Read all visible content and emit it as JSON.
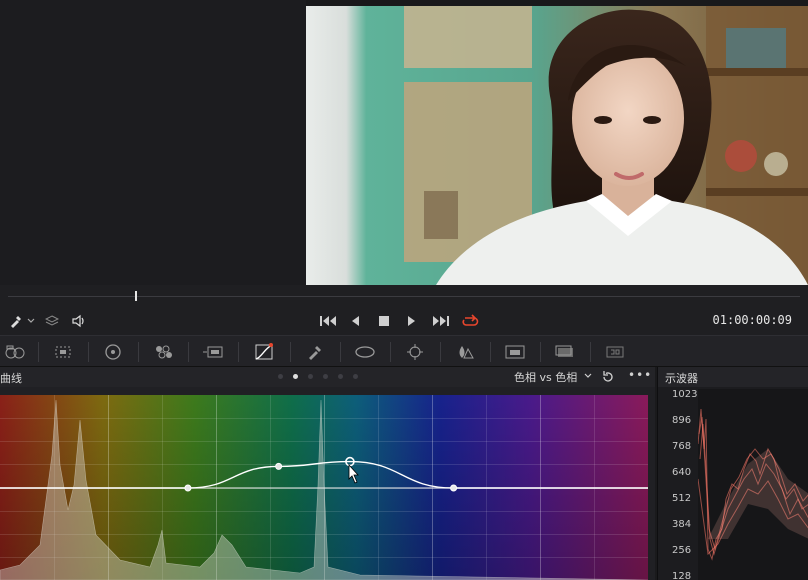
{
  "transport": {
    "timecode": "01:00:00:09",
    "playhead_fraction": 0.16,
    "loop_color": "#e8462d"
  },
  "curves": {
    "title": "曲线",
    "mode_label": "色相 vs 色相",
    "page_count": 6,
    "active_page": 1,
    "more_label": "•••",
    "control_points": [
      {
        "hue": 0.29,
        "offset": 0.0
      },
      {
        "hue": 0.43,
        "offset": 0.18
      },
      {
        "hue": 0.54,
        "offset": 0.22
      },
      {
        "hue": 0.7,
        "offset": 0.0
      }
    ],
    "active_point_index": 2
  },
  "waveform": {
    "title": "示波器",
    "scale": [
      "1023",
      "896",
      "768",
      "640",
      "512",
      "384",
      "256",
      "128"
    ],
    "trace_color": "#ff7a6a"
  },
  "palette": {
    "tools": [
      "camera-raw-icon",
      "color-match-icon",
      "color-wheels-icon",
      "rgb-mixer-icon",
      "motion-effects-icon",
      "curves-icon",
      "qualifier-icon",
      "window-icon",
      "tracker-icon",
      "blur-icon",
      "key-icon",
      "sizing-icon",
      "3d-icon"
    ]
  }
}
